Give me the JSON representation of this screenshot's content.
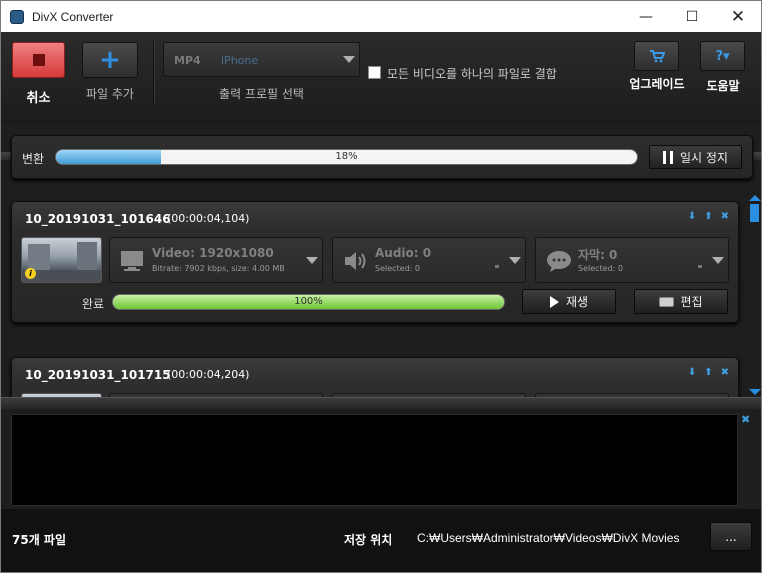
{
  "window": {
    "title": "DivX Converter",
    "minimize": "—",
    "maximize": "☐",
    "close": "✕"
  },
  "toolbar": {
    "cancel_label": "취소",
    "add_file_label": "파일 추가",
    "add_file_icon": "+",
    "profile_format": "MP4",
    "profile_device": "iPhone",
    "profile_label": "출력 프로필 선택",
    "join_label": "모든 비디오를 하나의 파일로 결합",
    "join_checked": false,
    "upgrade_label": "업그레이드",
    "help_icon": "?▾",
    "help_label": "도움말"
  },
  "conversion": {
    "label": "변환",
    "percent_text": "18%",
    "percent": 18,
    "pause_label": "일시 정지"
  },
  "files": [
    {
      "name": "10_20191031_101646",
      "duration": "(00:00:04,104)",
      "video_title": "Video: 1920x1080",
      "video_sub": "Bitrate: 7902 kbps, size: 4.00 MB",
      "audio_title": "Audio: 0",
      "audio_sub": "Selected: 0",
      "subtitle_title": "자막: 0",
      "subtitle_sub": "Selected: 0",
      "status_label": "완료",
      "progress_text": "100%",
      "progress": 100,
      "play_label": "재생",
      "edit_label": "편집",
      "info_badge": "i",
      "action_icons": [
        "⬇",
        "⬆",
        "✖"
      ]
    },
    {
      "name": "10_20191031_101715",
      "duration": "(00:00:04,204)",
      "action_icons": [
        "⬇",
        "⬆",
        "✖"
      ]
    }
  ],
  "log": {
    "close_icon": "✖"
  },
  "status": {
    "file_count": "75개 파일",
    "save_label": "저장 위치",
    "save_path": "C:₩Users₩Administrator₩Videos₩DivX Movies",
    "browse_label": "..."
  },
  "colors": {
    "accent_blue": "#2a8fe0",
    "cancel_red": "#d63a3a",
    "progress_blue": "#3f9dd6",
    "progress_green": "#6cc534"
  }
}
